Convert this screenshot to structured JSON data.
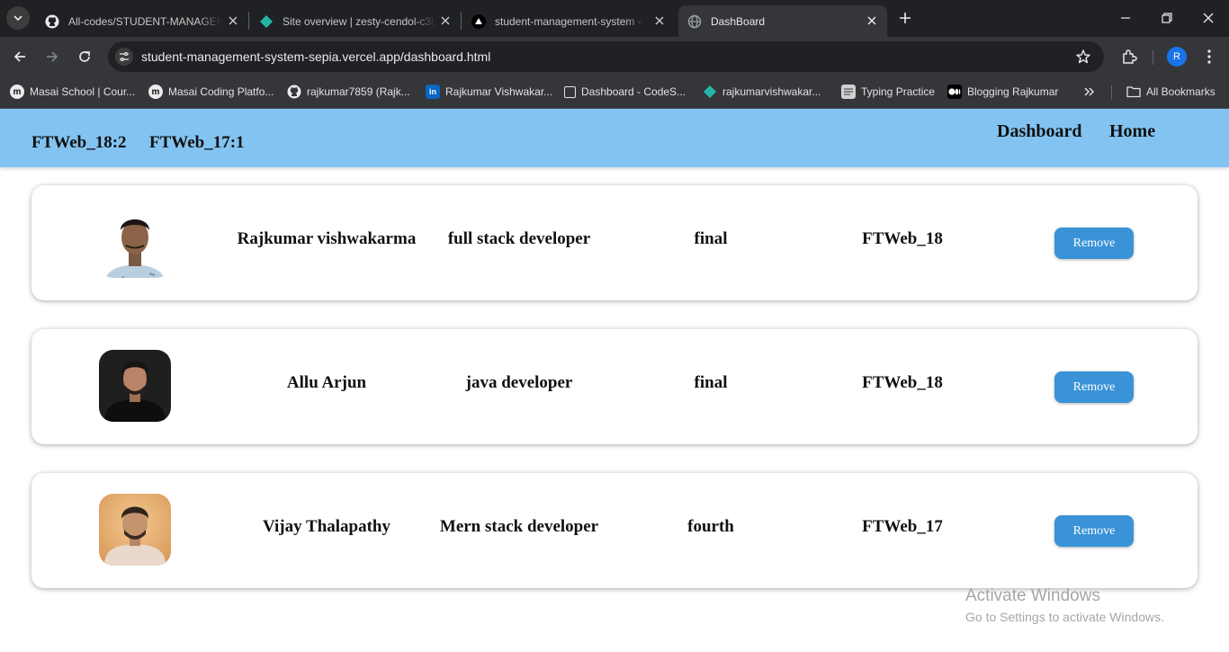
{
  "browser": {
    "tabs": [
      {
        "title": "All-codes/STUDENT-MANAGEMENT",
        "favicon": "github-icon"
      },
      {
        "title": "Site overview | zesty-cendol-c3b",
        "favicon": "netlify-icon"
      },
      {
        "title": "student-management-system - ",
        "favicon": "vercel-icon"
      },
      {
        "title": "DashBoard",
        "favicon": "globe-icon"
      }
    ],
    "url": "student-management-system-sepia.vercel.app/dashboard.html",
    "profile_initial": "R",
    "bookmarks": [
      {
        "label": "Masai School | Cour...",
        "icon": "masai-icon"
      },
      {
        "label": "Masai Coding Platfo...",
        "icon": "masai-icon"
      },
      {
        "label": "rajkumar7859 (Rajk...",
        "icon": "github-icon"
      },
      {
        "label": "Rajkumar Vishwakar...",
        "icon": "linkedin-icon"
      },
      {
        "label": "Dashboard - CodeS...",
        "icon": "codesignal-icon"
      },
      {
        "label": "rajkumarvishwakar...",
        "icon": "netlify-icon"
      },
      {
        "label": "Typing Practice",
        "icon": "typing-icon"
      },
      {
        "label": "Blogging Rajkumar",
        "icon": "medium-icon"
      }
    ],
    "all_bookmarks_label": "All Bookmarks"
  },
  "nav": {
    "count_18": "FTWeb_18:2",
    "count_17": "FTWeb_17:1",
    "dashboard_link": "Dashboard",
    "home_link": "Home"
  },
  "students": [
    {
      "name": "Rajkumar vishwakarma",
      "course": "full stack developer",
      "unit": "final",
      "batch": "FTWeb_18",
      "remove_label": "Remove",
      "photo_colors": [
        "#dbe6ee",
        "#8fb1c8",
        "#2a2220"
      ]
    },
    {
      "name": "Allu Arjun",
      "course": "java developer",
      "unit": "final",
      "batch": "FTWeb_18",
      "remove_label": "Remove",
      "photo_colors": [
        "#1b1b1b",
        "#2e2e2e",
        "#b88366"
      ]
    },
    {
      "name": "Vijay Thalapathy",
      "course": "Mern stack developer",
      "unit": "fourth",
      "batch": "FTWeb_17",
      "remove_label": "Remove",
      "photo_colors": [
        "#e6b27a",
        "#f1d5bb",
        "#3b2a22"
      ]
    }
  ],
  "watermark": {
    "title": "Activate Windows",
    "subtitle": "Go to Settings to activate Windows."
  }
}
